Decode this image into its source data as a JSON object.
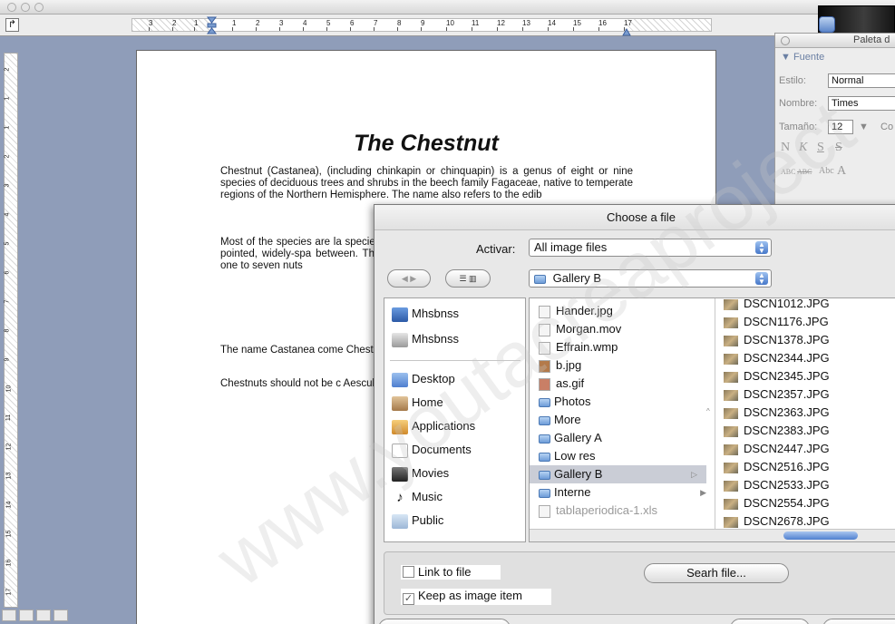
{
  "document": {
    "title": "The Chestnut",
    "paragraphs": [
      "Chestnut (Castanea), (including chinkapin or chinquapin) is a genus of eight or nine species of deciduous trees and shrubs in the beech family Fagaceae, native to temperate regions of the Northern Hemisphere. The name also refers to the edib",
      "Most of the species are la species (the chinkapins) a simple, ovate or lanceolate sharply pointed, widely-spa between. The flowers are c heavy, unpleasant odour. T containing one to seven nuts",
      "The name Castanea come Chestnut.",
      "Chestnuts should not be c Aesculus), or water-chestnu producing respectively nuts taste."
    ]
  },
  "ruler": {
    "corner_glyph": "↱",
    "labels": [
      "3",
      "2",
      "1",
      "1",
      "2",
      "3",
      "4",
      "5",
      "6",
      "7",
      "8",
      "9",
      "10",
      "11",
      "12",
      "13",
      "14",
      "15",
      "16",
      "17"
    ]
  },
  "vruler": {
    "labels": [
      "2",
      "1",
      "1",
      "2",
      "3",
      "4",
      "5",
      "6",
      "7",
      "8",
      "9",
      "10",
      "11",
      "12",
      "13",
      "14",
      "15",
      "16",
      "17"
    ]
  },
  "palette": {
    "title": "Paleta d",
    "section": "▼ Fuente",
    "estilo_label": "Estilo:",
    "estilo_value": "Normal",
    "nombre_label": "Nombre:",
    "nombre_value": "Times",
    "tamano_label": "Tamaño:",
    "tamano_value": "12",
    "tamano_suffix": "Co",
    "style_glyphs": [
      "N",
      "K",
      "S",
      "S"
    ],
    "effect_glyphs": [
      "ABC",
      "ABC",
      "Abc",
      "A"
    ]
  },
  "dialog": {
    "title": "Choose a file",
    "activar_label": "Activar:",
    "activar_value": "All image files",
    "location_value": "Gallery B",
    "sidebar": [
      {
        "label": "Mhsbnss",
        "icon": "computer-icon"
      },
      {
        "label": "Mhsbnss",
        "icon": "disk-icon"
      },
      {
        "label": "Desktop",
        "icon": "desktop-icon"
      },
      {
        "label": "Home",
        "icon": "home-icon"
      },
      {
        "label": "Applications",
        "icon": "applications-icon"
      },
      {
        "label": "Documents",
        "icon": "documents-icon"
      },
      {
        "label": "Movies",
        "icon": "movies-icon"
      },
      {
        "label": "Music",
        "icon": "music-icon"
      },
      {
        "label": "Public",
        "icon": "public-icon"
      }
    ],
    "column1": [
      {
        "label": "Hander.jpg",
        "kind": "file"
      },
      {
        "label": "Morgan.mov",
        "kind": "file"
      },
      {
        "label": "Effrain.wmp",
        "kind": "file"
      },
      {
        "label": "b.jpg",
        "kind": "file"
      },
      {
        "label": "as.gif",
        "kind": "file"
      },
      {
        "label": "Photos",
        "kind": "folder"
      },
      {
        "label": "More",
        "kind": "folder"
      },
      {
        "label": "Gallery A",
        "kind": "folder"
      },
      {
        "label": "Low res",
        "kind": "folder"
      },
      {
        "label": "Gallery B",
        "kind": "folder",
        "selected": true
      },
      {
        "label": "Interne",
        "kind": "folder"
      },
      {
        "label": "tablaperiodica-1.xls",
        "kind": "file",
        "dim": true
      }
    ],
    "column2": [
      "DSCN1012.JPG",
      "DSCN1176.JPG",
      "DSCN1378.JPG",
      "DSCN2344.JPG",
      "DSCN2345.JPG",
      "DSCN2357.JPG",
      "DSCN2363.JPG",
      "DSCN2383.JPG",
      "DSCN2447.JPG",
      "DSCN2516.JPG",
      "DSCN2533.JPG",
      "DSCN2554.JPG",
      "DSCN2678.JPG"
    ],
    "link_label": "Link to file",
    "keep_label": "Keep as image item",
    "search_label": "Searh file..."
  },
  "watermark": "www.youtacreaproject"
}
